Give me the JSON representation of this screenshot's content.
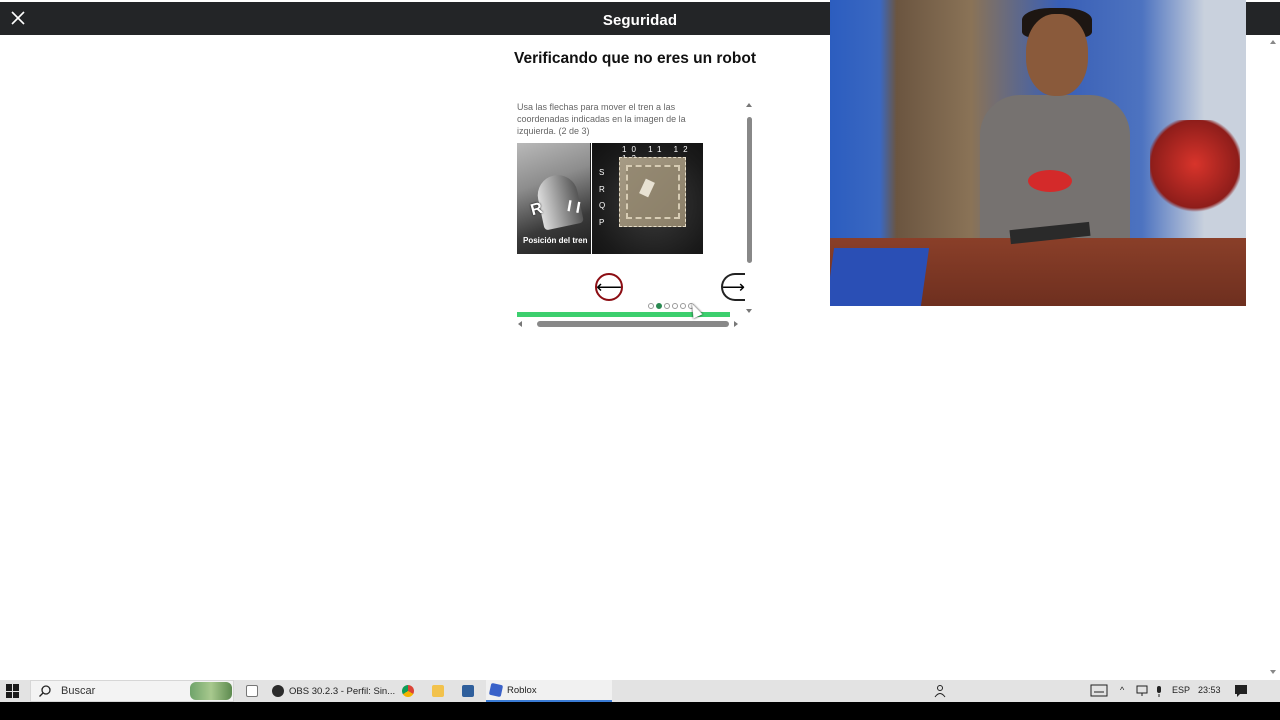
{
  "window": {
    "title": "Seguridad"
  },
  "captcha": {
    "heading": "Verificando que no eres un robot",
    "instructions": "Usa las flechas para mover el tren a las coordenadas indicadas en la imagen de la izquierda. (2 de 3)",
    "reference_caption": "Posición del tren",
    "reference_letter": "R",
    "column_labels": "10 11 12 13",
    "row_labels": [
      "S",
      "R",
      "Q",
      "P"
    ],
    "prev_button_icon": "arrow-left-icon",
    "next_button_icon": "arrow-right-icon",
    "prev_glyph": "⟵",
    "next_glyph": "⟶",
    "dots_total": 6,
    "dots_active_index": 1,
    "progress_fraction": 1.0,
    "colors": {
      "progress": "#3ccf6e",
      "prev_border": "#8c0d13",
      "active_dot": "#2a8a52"
    }
  },
  "taskbar": {
    "search_placeholder": "Buscar",
    "items": [
      {
        "label": "",
        "icon": "file-icon"
      },
      {
        "label": "OBS 30.2.3 - Perfil: Sin...",
        "icon": "obs-icon"
      },
      {
        "label": "",
        "icon": "chrome-icon"
      },
      {
        "label": "",
        "icon": "folder-icon"
      },
      {
        "label": "",
        "icon": "app-icon"
      },
      {
        "label": "Roblox",
        "icon": "roblox-icon"
      }
    ],
    "tray": {
      "language": "ESP",
      "time": "23:53"
    }
  }
}
